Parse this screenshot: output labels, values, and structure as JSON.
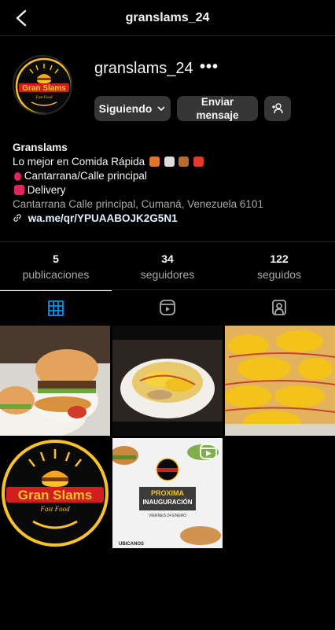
{
  "header": {
    "username": "granslams_24",
    "back_icon": "chevron-left-icon"
  },
  "profile": {
    "username": "granslams_24",
    "more_label": "•••",
    "follow_label": "Siguiendo",
    "message_line1": "Enviar",
    "message_line2": "mensaje",
    "logo_text": "Gran Slams",
    "logo_subtext": "Fast Food"
  },
  "bio": {
    "name": "Granslams",
    "line1": "Lo mejor en Comida Rápida",
    "line2": "Cantarrana/Calle principal",
    "line3": "Delivery",
    "address": "Cantarrana Calle principal, Cumaná, Venezuela 6101",
    "link": "wa.me/qr/YPUAABOJK2G5N1"
  },
  "stats": [
    {
      "value": "5",
      "label": "publicaciones"
    },
    {
      "value": "34",
      "label": "seguidores"
    },
    {
      "value": "122",
      "label": "seguidos"
    }
  ],
  "tabs": [
    "grid-icon",
    "reels-icon",
    "tagged-icon"
  ],
  "posts": [
    {
      "kind": "burger"
    },
    {
      "kind": "plate"
    },
    {
      "kind": "hotdogs"
    },
    {
      "kind": "logo",
      "text": "Gran Slams",
      "subtext": "Fast Food"
    },
    {
      "kind": "poster",
      "line1": "PROXIMA",
      "line2": "INAUGURACIÓN",
      "line3": "VIERNES 24 ENERO",
      "footer": "UBICANOS"
    }
  ],
  "colors": {
    "accent": "#0095f6",
    "logo_red": "#d21e1e",
    "logo_yellow": "#f7c22b"
  }
}
